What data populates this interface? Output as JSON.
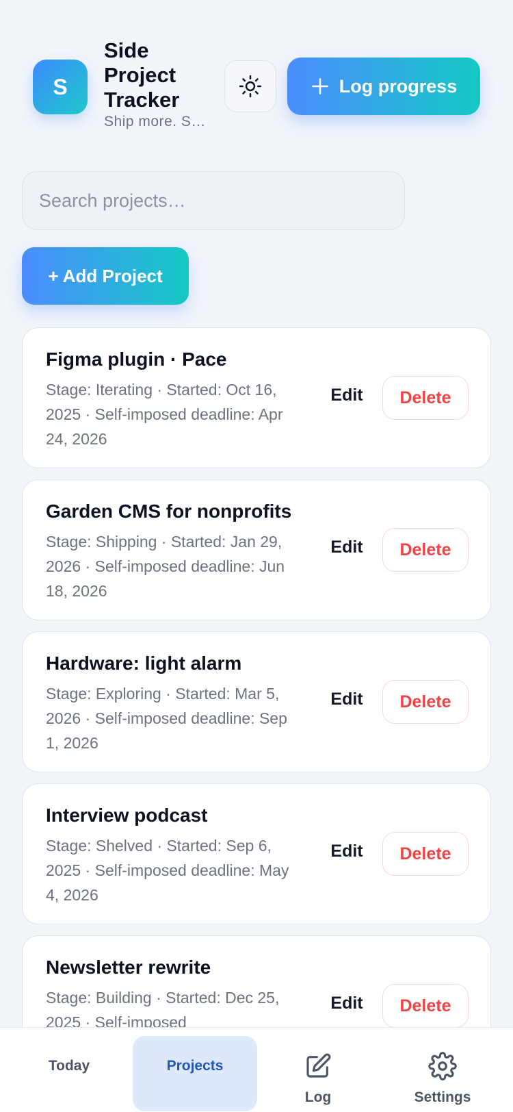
{
  "header": {
    "logo_letter": "S",
    "title": "Side Project Tracker",
    "subtitle": "Ship more. Ship better.",
    "theme_toggle_icon": "sun-icon",
    "log_button": {
      "icon": "plus-icon",
      "label": "Log progress"
    }
  },
  "search": {
    "placeholder": "Search projects…",
    "value": ""
  },
  "add_project_label": "+ Add Project",
  "projects": [
    {
      "name": "Figma plugin · Pace",
      "meta": "Stage: Iterating · Started: Oct 16, 2025 · Self-imposed deadline: Apr 24, 2026",
      "edit_label": "Edit",
      "delete_label": "Delete"
    },
    {
      "name": "Garden CMS for nonprofits",
      "meta": "Stage: Shipping · Started: Jan 29, 2026 · Self-imposed deadline: Jun 18, 2026",
      "edit_label": "Edit",
      "delete_label": "Delete"
    },
    {
      "name": "Hardware: light alarm",
      "meta": "Stage: Exploring · Started: Mar 5, 2026 · Self-imposed deadline: Sep 1, 2026",
      "edit_label": "Edit",
      "delete_label": "Delete"
    },
    {
      "name": "Interview podcast",
      "meta": "Stage: Shelved · Started: Sep 6, 2025 · Self-imposed deadline: May 4, 2026",
      "edit_label": "Edit",
      "delete_label": "Delete"
    },
    {
      "name": "Newsletter rewrite",
      "meta": "Stage: Building · Started: Dec 25, 2025 · Self-imposed",
      "edit_label": "Edit",
      "delete_label": "Delete"
    }
  ],
  "bottom_nav": {
    "items": [
      {
        "label": "Today",
        "icon": "",
        "active": false
      },
      {
        "label": "Projects",
        "icon": "",
        "active": true
      },
      {
        "label": "Log",
        "icon": "edit-icon",
        "active": false
      },
      {
        "label": "Settings",
        "icon": "gear-icon",
        "active": false
      }
    ]
  },
  "colors": {
    "accent_start": "#4b8dff",
    "accent_end": "#15c9c4",
    "danger": "#ef4444",
    "active_nav_bg": "#dde8fb",
    "active_nav_text": "#2456b8"
  }
}
